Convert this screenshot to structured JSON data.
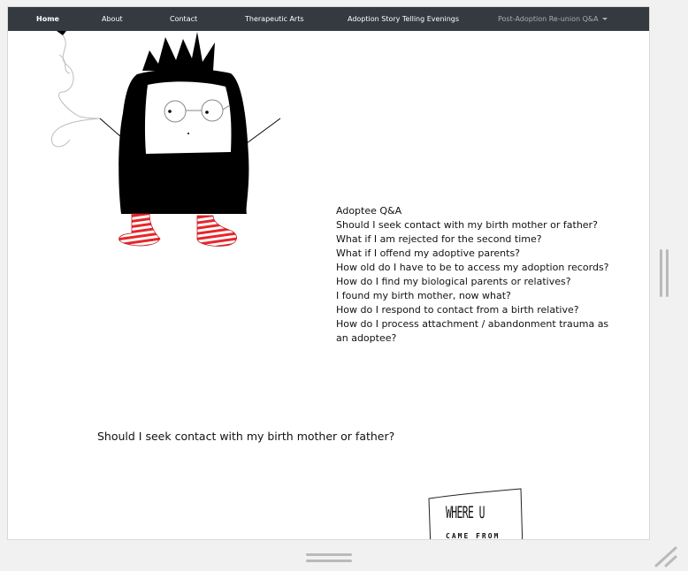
{
  "nav": {
    "items": [
      {
        "label": "Home",
        "active": true
      },
      {
        "label": "About"
      },
      {
        "label": "Contact"
      },
      {
        "label": "Therapeutic Arts"
      },
      {
        "label": "Adoption Story Telling Evenings"
      },
      {
        "label": "Post-Adoption Re-union Q&A",
        "dropdown": true
      }
    ]
  },
  "qa": {
    "title": "Adoptee Q&A",
    "questions": [
      "Should I seek contact with my birth mother or father?",
      "What if I am rejected for the second time?",
      "What if I offend my adoptive parents?",
      "How old do I have to be to access my adoption records?",
      "How do I find my biological parents or relatives?",
      "I found my birth mother, now what?",
      "How do I respond to contact from a birth relative?",
      "How do I process attachment / abandonment trauma as an adoptee?"
    ]
  },
  "section": {
    "heading": "Should I seek contact with my birth mother or father?"
  },
  "card": {
    "title": "WHERE U",
    "subtitle": "CAME FROM"
  },
  "colors": {
    "navbar": "#343a40",
    "nav_text": "#ffffff",
    "nav_muted": "#a8adb2",
    "creature_body": "#000000",
    "stripe": "#e8252a"
  },
  "icons": {
    "dropdown": "caret-down-icon",
    "resize": "resize-grip-icon"
  }
}
